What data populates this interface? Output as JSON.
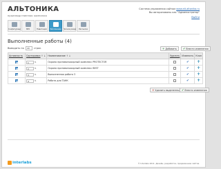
{
  "header": {
    "logo_title": "АЛЬТОНИКА",
    "logo_subtitle": "производственная компания",
    "site_prefix": "Система управления сайтом",
    "site_link": "www.alt-altonika.ru",
    "user_line": "Вы авторизованы как \"Администратор\"",
    "logout": "Выйти"
  },
  "nav": {
    "items": [
      {
        "label": "Конфигурация"
      },
      {
        "label": "SEO"
      },
      {
        "label": "Навигация"
      },
      {
        "label": "Заполнение"
      },
      {
        "label": "Прочие разделы"
      },
      {
        "label": "Рассылка"
      }
    ],
    "active_index": 3
  },
  "page": {
    "title": "Выполненные работы (4)",
    "show_label": "Выводить по",
    "show_value": "20",
    "show_after": "строк"
  },
  "buttons": {
    "add": "Добавить",
    "save": "Внести изменения",
    "delete_selected": "Удалить выделенные строки",
    "save_bottom": "Внести изменения"
  },
  "table": {
    "headers": {
      "activity": "Активность",
      "sort": "Сортировка",
      "sort_marks": "↑ ↓",
      "name": "Наименование",
      "name_marks": "↑ ↓",
      "delete": "Удалить",
      "edit": "Изменить",
      "add": "Клон"
    },
    "rows": [
      {
        "active": true,
        "sort": "1",
        "name": "Охрана противопожарный комплекс PROTECTOR",
        "delete": false
      },
      {
        "active": true,
        "sort": "2",
        "name": "Охрана противопожарный комплекс BEST",
        "delete": false
      },
      {
        "active": true,
        "sort": "3",
        "name": "Выполненная работа 3",
        "delete": false
      },
      {
        "active": true,
        "sort": "4",
        "name": "Работа для ТАНК",
        "delete": false
      }
    ]
  },
  "footer": {
    "brand": "interlabs",
    "copyright_prefix": "© Interlabs 2011. Дизайн, разработка, продвижение сайтов.",
    "copyright_link": ""
  }
}
